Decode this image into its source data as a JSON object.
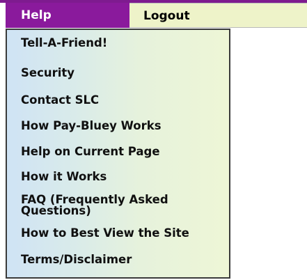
{
  "menubar": {
    "help_label": "Help",
    "logout_label": "Logout"
  },
  "help_menu": {
    "items": [
      {
        "label": "Tell-A-Friend!"
      },
      {
        "label": "Security"
      },
      {
        "label": "Contact SLC"
      },
      {
        "label": "How Pay-Bluey Works"
      },
      {
        "label": "Help on Current Page"
      },
      {
        "label": "How it Works"
      },
      {
        "label": "FAQ (Frequently Asked Questions)"
      },
      {
        "label": "How to Best View the Site"
      },
      {
        "label": "Terms/Disclaimer"
      }
    ]
  },
  "colors": {
    "menubar_accent": "#7e1b8f",
    "active_tab": "#8a1a9c",
    "inactive_tab": "#eef3c9",
    "dropdown_border": "#3a3a3a"
  }
}
